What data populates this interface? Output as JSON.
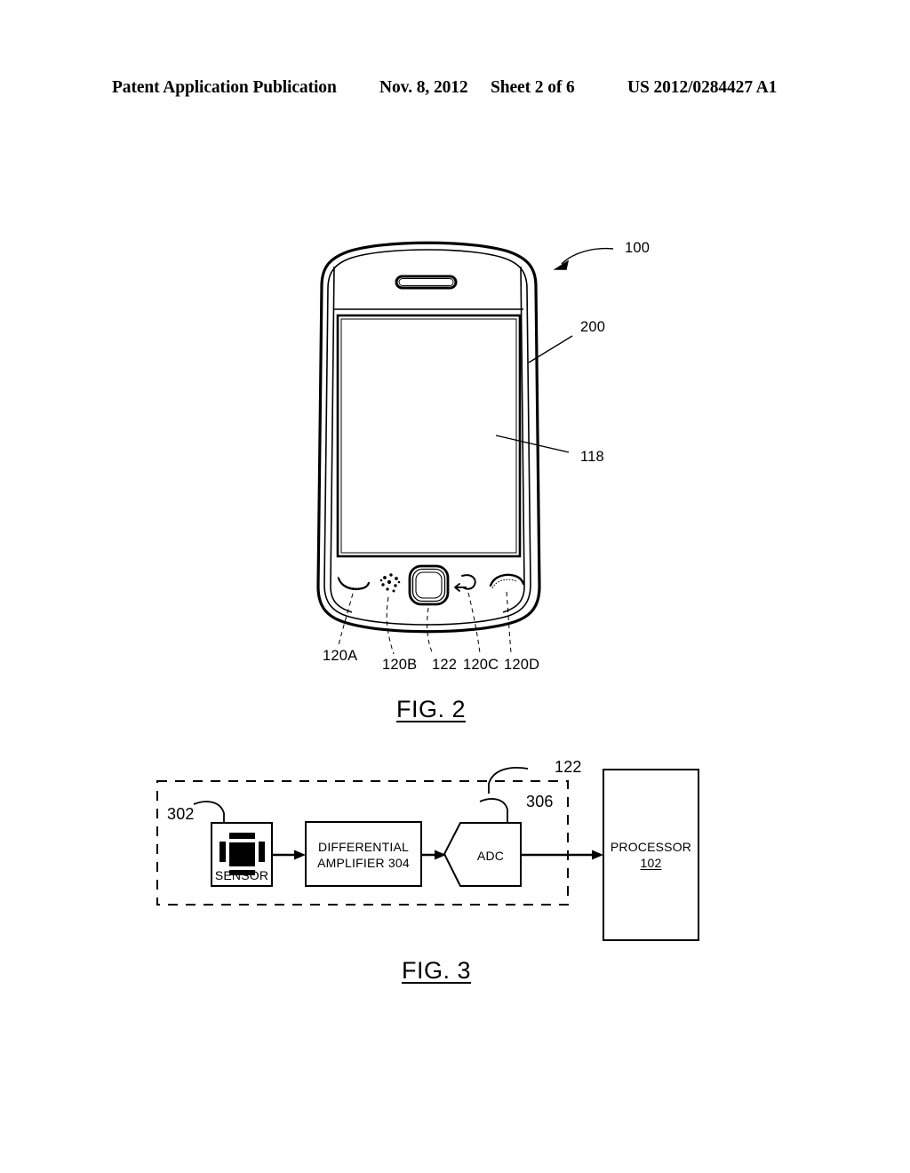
{
  "document": {
    "type": "patent-application-drawing-sheet",
    "header": {
      "publication": "Patent Application Publication",
      "date": "Nov. 8, 2012",
      "sheet": "Sheet 2 of 6",
      "publication_number": "US 2012/0284427 A1"
    }
  },
  "figures": [
    {
      "id": "fig2",
      "caption": "FIG. 2",
      "description": "Front view of a handheld mobile communication device",
      "callouts": [
        {
          "label": "100",
          "target": "device-body"
        },
        {
          "label": "200",
          "target": "device-housing-edge"
        },
        {
          "label": "118",
          "target": "display-screen"
        },
        {
          "label": "120A",
          "target": "send-call-key"
        },
        {
          "label": "120B",
          "target": "menu-key"
        },
        {
          "label": "122",
          "target": "trackpad-sensor"
        },
        {
          "label": "120C",
          "target": "back-key"
        },
        {
          "label": "120D",
          "target": "end-call-key"
        }
      ],
      "keys": [
        {
          "ref": "120A",
          "icon": "call-send-icon"
        },
        {
          "ref": "120B",
          "icon": "menu-dots-icon"
        },
        {
          "ref": "122",
          "icon": "trackpad-icon"
        },
        {
          "ref": "120C",
          "icon": "back-arrow-icon"
        },
        {
          "ref": "120D",
          "icon": "call-end-icon"
        }
      ]
    },
    {
      "id": "fig3",
      "caption": "FIG. 3",
      "description": "Block diagram of the trackpad sensing circuit",
      "enclosure_label": "122",
      "blocks": [
        {
          "id": "sensor",
          "label": "SENSOR",
          "ref": "302",
          "shape": "rect"
        },
        {
          "id": "amplifier",
          "label": "DIFFERENTIAL",
          "label_line2": "AMPLIFIER 304",
          "ref": "304",
          "shape": "rect"
        },
        {
          "id": "adc",
          "label": "ADC",
          "ref": "306",
          "shape": "pentagon"
        },
        {
          "id": "processor",
          "label": "PROCESSOR",
          "label_line2": "102",
          "ref": "102",
          "shape": "rect"
        }
      ],
      "signal_flow": [
        "sensor",
        "amplifier",
        "adc",
        "processor"
      ]
    }
  ],
  "colors": {
    "ink": "#000000",
    "paper": "#ffffff"
  }
}
